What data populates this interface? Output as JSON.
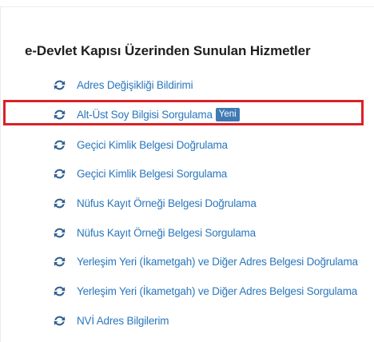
{
  "panel": {
    "title": "e-Devlet Kapısı Üzerinden Sunulan Hizmetler"
  },
  "services": [
    {
      "label": "Adres Değişikliği Bildirimi",
      "icon": "refresh-icon"
    },
    {
      "label": "Alt-Üst Soy Bilgisi Sorgulama",
      "icon": "refresh-icon",
      "badge": "Yeni",
      "highlighted": true
    },
    {
      "label": "Geçici Kimlik Belgesi Doğrulama",
      "icon": "refresh-icon"
    },
    {
      "label": "Geçici Kimlik Belgesi Sorgulama",
      "icon": "refresh-icon"
    },
    {
      "label": "Nüfus Kayıt Örneği Belgesi Doğrulama",
      "icon": "refresh-icon"
    },
    {
      "label": "Nüfus Kayıt Örneği Belgesi Sorgulama",
      "icon": "refresh-icon"
    },
    {
      "label": "Yerleşim Yeri (İkametgah) ve Diğer Adres Belgesi Doğrulama",
      "icon": "refresh-icon"
    },
    {
      "label": "Yerleşim Yeri (İkametgah) ve Diğer Adres Belgesi Sorgulama",
      "icon": "refresh-icon"
    },
    {
      "label": "NVİ Adres Bilgilerim",
      "icon": "refresh-icon"
    }
  ],
  "colors": {
    "link": "#2a77bd",
    "icon": "#2e5f91",
    "badge_bg": "#3f7ab3",
    "highlight_border": "#d92128",
    "title": "#1f1f1f"
  }
}
